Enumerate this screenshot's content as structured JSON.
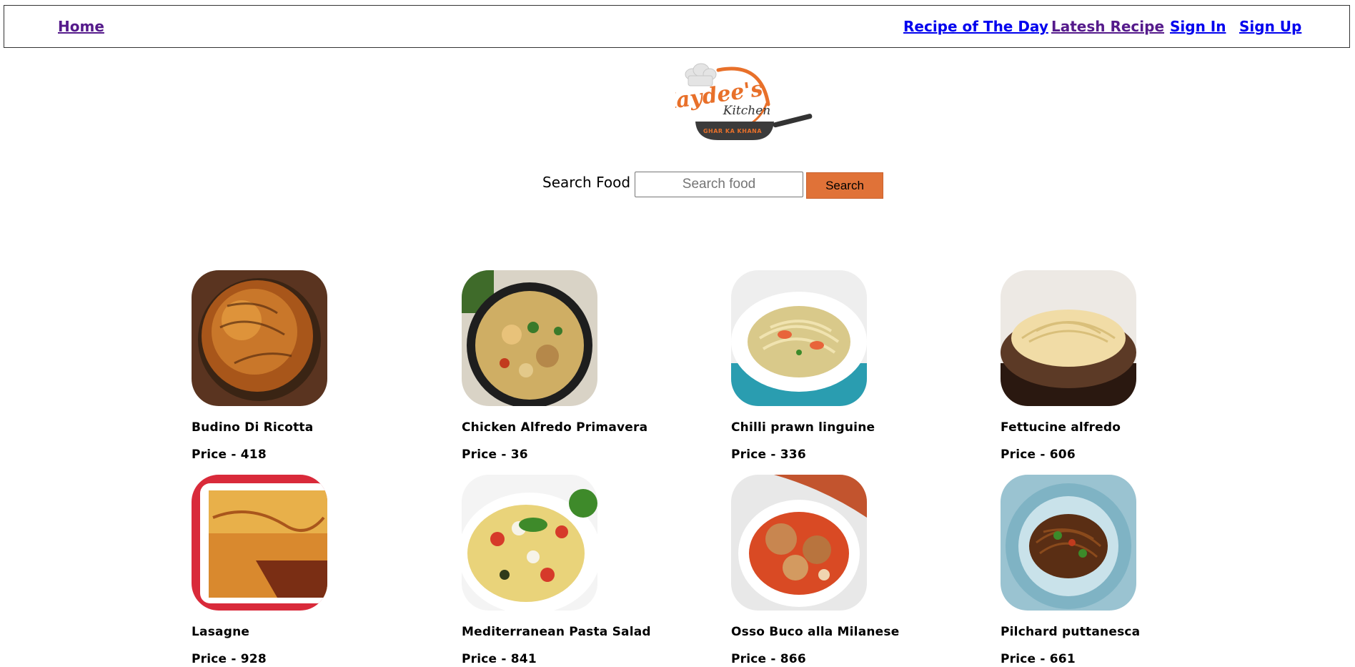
{
  "nav": {
    "home": "Home",
    "recipe_of_the_day": "Recipe of The Day",
    "latest_recipe": "Latesh Recipe",
    "sign_in": "Sign In",
    "sign_up": "Sign Up"
  },
  "logo": {
    "line1": "Kaydee's",
    "line2": "Kitchen",
    "tagline": "GHAR KA KHANA"
  },
  "search": {
    "label": "Search Food",
    "placeholder": "Search food",
    "button": "Search"
  },
  "price_prefix": "Price - ",
  "foods": [
    {
      "name": "Budino Di Ricotta",
      "price": "Price - 418"
    },
    {
      "name": "Chicken Alfredo Primavera",
      "price": "Price - 36"
    },
    {
      "name": "Chilli prawn linguine",
      "price": "Price - 336"
    },
    {
      "name": "Fettucine alfredo",
      "price": "Price - 606"
    },
    {
      "name": "Lasagne",
      "price": "Price - 928"
    },
    {
      "name": "Mediterranean Pasta Salad",
      "price": "Price - 841"
    },
    {
      "name": "Osso Buco alla Milanese",
      "price": "Price - 866"
    },
    {
      "name": "Pilchard puttanesca",
      "price": "Price - 661"
    }
  ],
  "colors": {
    "search_button": "#e07238",
    "link_visited": "#551a8b",
    "link_default": "#0000ee",
    "logo_orange": "#e8702a"
  }
}
